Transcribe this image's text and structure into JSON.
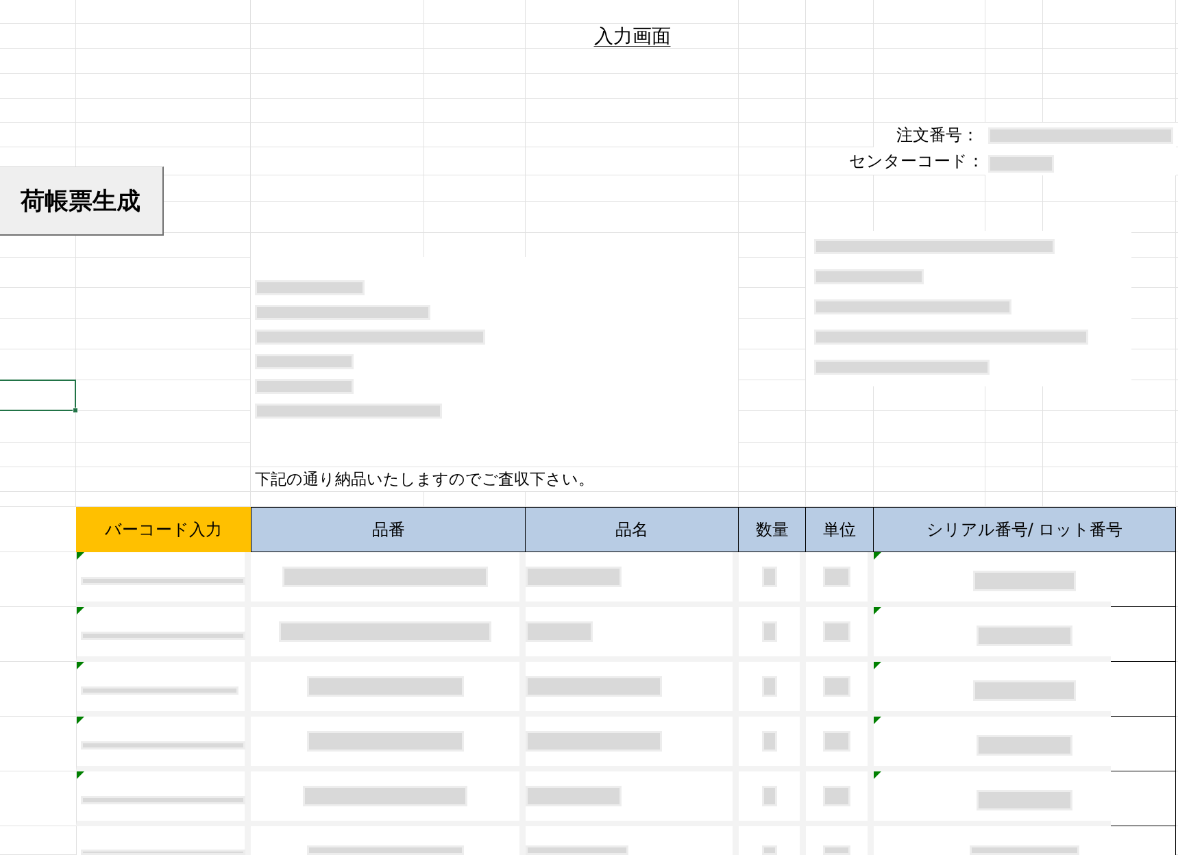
{
  "title": "入力画面",
  "order_fields": [
    {
      "label": "注文番号："
    },
    {
      "label": "センターコード："
    }
  ],
  "generate_button": {
    "label": "荷帳票生成"
  },
  "cell_cursor": {
    "shown": true
  },
  "notice": "下記の通り納品いたしますのでご査収下さい。",
  "table": {
    "columns": [
      {
        "label": "バーコード入力",
        "color": "#ffc000"
      },
      {
        "label": "品番",
        "color": "#b8cce4"
      },
      {
        "label": "品名",
        "color": "#b8cce4"
      },
      {
        "label": "数量",
        "color": "#b8cce4"
      },
      {
        "label": "単位",
        "color": "#b8cce4"
      },
      {
        "label": "シリアル番号/ ロット番号",
        "color": "#b8cce4"
      }
    ],
    "rows": [
      {
        "error_indicator": true
      },
      {
        "error_indicator": true
      },
      {
        "error_indicator": true
      },
      {
        "error_indicator": true
      },
      {
        "error_indicator": true
      },
      {
        "error_indicator": false
      }
    ]
  }
}
